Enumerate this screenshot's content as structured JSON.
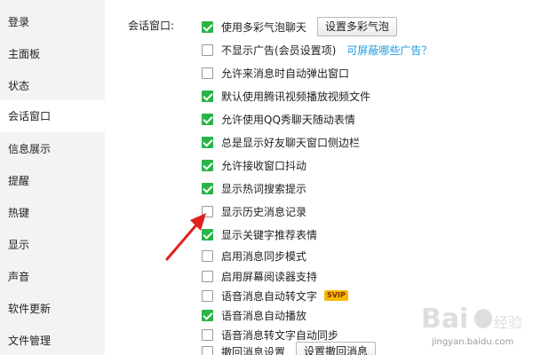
{
  "sidebar": {
    "items": [
      {
        "label": "登录"
      },
      {
        "label": "主面板"
      },
      {
        "label": "状态"
      },
      {
        "label": "会话窗口",
        "active": true
      },
      {
        "label": "信息展示"
      },
      {
        "label": "提醒"
      },
      {
        "label": "热键"
      },
      {
        "label": "显示"
      },
      {
        "label": "声音"
      },
      {
        "label": "软件更新"
      },
      {
        "label": "文件管理"
      }
    ]
  },
  "section": {
    "label": "会话窗口:",
    "options": [
      {
        "label": "使用多彩气泡聊天",
        "checked": true,
        "button": "设置多彩气泡"
      },
      {
        "label": "不显示广告(会员设置项)",
        "checked": false,
        "link": "可屏蔽哪些广告？"
      },
      {
        "label": "允许来消息时自动弹出窗口",
        "checked": false
      },
      {
        "label": "默认使用腾讯视频播放视频文件",
        "checked": true
      },
      {
        "label": "允许使用QQ秀聊天随动表情",
        "checked": true
      },
      {
        "label": "总是显示好友聊天窗口侧边栏",
        "checked": true
      },
      {
        "label": "允许接收窗口抖动",
        "checked": true
      },
      {
        "label": "显示热词搜索提示",
        "checked": true
      },
      {
        "label": "显示历史消息记录",
        "checked": false
      },
      {
        "label": "显示关键字推荐表情",
        "checked": true
      },
      {
        "label": "启用消息同步模式",
        "checked": false
      },
      {
        "label": "启用屏幕阅读器支持",
        "checked": false
      },
      {
        "label": "语音消息自动转文字",
        "checked": false,
        "badge": "SVIP"
      },
      {
        "label": "语音消息自动播放",
        "checked": true
      },
      {
        "label": "语音消息转文字自动同步",
        "checked": false
      },
      {
        "label": "撤回消息设置",
        "checked": false,
        "button": "设置撤回消息"
      }
    ]
  },
  "watermark": {
    "text": "jingyan.baidu.com"
  },
  "colors": {
    "check": "#2ab34a",
    "link": "#1e9be0",
    "arrow": "#e02020",
    "sidebar_bg": "#f3f3f3"
  }
}
